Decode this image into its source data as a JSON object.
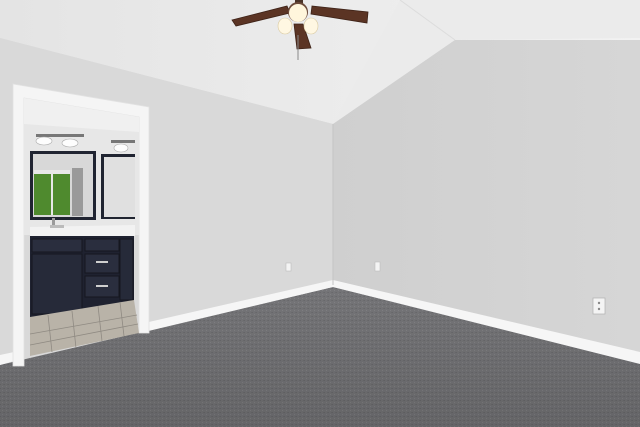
{
  "scene": {
    "description_label": "",
    "colors": {
      "ceiling": "#ececec",
      "wall_left": "#d9d9d9",
      "wall_right": "#d2d2d2",
      "carpet": "#7a7a7d",
      "baseboard": "#f6f6f6",
      "door_trim": "#f5f5f5",
      "vanity": "#1f2230",
      "fan_blade": "#5b3424",
      "tile": "#b9b3a8",
      "window_green": "#4f8a2e"
    }
  }
}
